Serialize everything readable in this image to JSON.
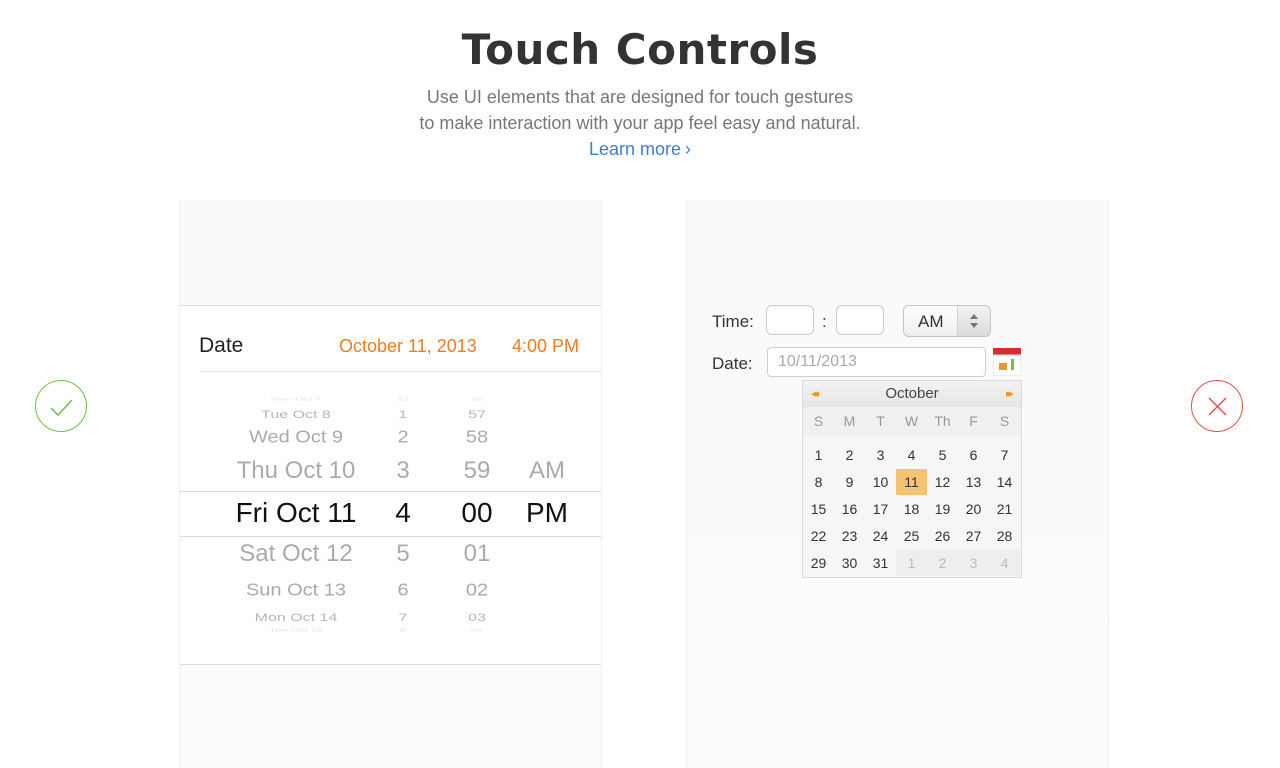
{
  "header": {
    "title": "Touch Controls",
    "subtitle_line1": "Use UI elements that are designed for touch gestures",
    "subtitle_line2": "to make interaction with your app feel easy and natural.",
    "learn_more": "Learn more",
    "learn_more_chevron": "›"
  },
  "colors": {
    "good": "#6cc24a",
    "bad": "#e84c4c",
    "accent_orange": "#f07b22",
    "link_blue": "#3f7fd0",
    "calendar_today": "#f6c36e"
  },
  "good_example": {
    "icon": "checkmark-icon",
    "row_label": "Date",
    "row_date": "October 11, 2013",
    "row_time": "4:00 PM",
    "picker": {
      "days": [
        "Mon Oct 7",
        "Tue Oct 8",
        "Wed Oct 9",
        "Thu Oct 10",
        "Fri Oct 11",
        "Sat Oct 12",
        "Sun Oct 13",
        "Mon Oct 14",
        "Tue Oct 15"
      ],
      "hours": [
        "12",
        "1",
        "2",
        "3",
        "4",
        "5",
        "6",
        "7",
        "8"
      ],
      "minutes": [
        "56",
        "57",
        "58",
        "59",
        "00",
        "01",
        "02",
        "03",
        "04"
      ],
      "ampm": [
        "",
        "",
        "",
        "AM",
        "PM",
        "",
        "",
        "",
        ""
      ],
      "selected_day": "Fri Oct 11",
      "selected_hour": "4",
      "selected_minute": "00",
      "selected_ampm": "PM"
    }
  },
  "bad_example": {
    "icon": "cross-icon",
    "time_label": "Time:",
    "time_separator": ":",
    "ampm_value": "AM",
    "date_label": "Date:",
    "date_value": "10/11/2013",
    "calendar_button_icon": "calendar-icon",
    "calendar": {
      "month": "October",
      "prev": "◂◂",
      "next": "▸▸",
      "weekdays": [
        "S",
        "M",
        "T",
        "W",
        "Th",
        "F",
        "S"
      ],
      "weeks": [
        [
          "1",
          "2",
          "3",
          "4",
          "5",
          "6",
          "7"
        ],
        [
          "8",
          "9",
          "10",
          "11",
          "12",
          "13",
          "14"
        ],
        [
          "15",
          "16",
          "17",
          "18",
          "19",
          "20",
          "21"
        ],
        [
          "22",
          "23",
          "24",
          "25",
          "26",
          "27",
          "28"
        ],
        [
          "29",
          "30",
          "31",
          "1",
          "2",
          "3",
          "4"
        ]
      ],
      "today": "11",
      "next_month_days_in_last_row": 4
    }
  }
}
